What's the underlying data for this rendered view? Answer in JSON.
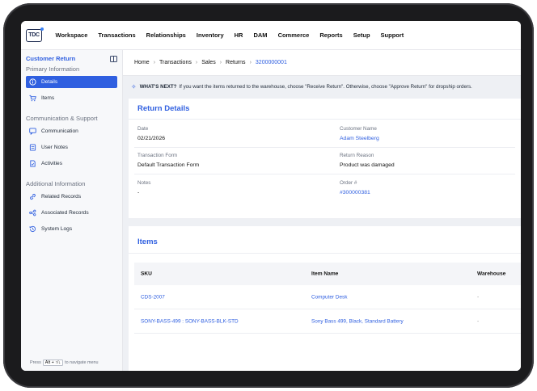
{
  "logo": {
    "text": "TDC"
  },
  "nav": [
    "Workspace",
    "Transactions",
    "Relationships",
    "Inventory",
    "HR",
    "DAM",
    "Commerce",
    "Reports",
    "Setup",
    "Support"
  ],
  "sidebar": {
    "title": "Customer Return",
    "sections": [
      {
        "label": "Primary Information",
        "items": [
          {
            "label": "Details",
            "icon": "info-icon",
            "active": true
          },
          {
            "label": "Items",
            "icon": "cart-icon",
            "active": false
          }
        ]
      },
      {
        "label": "Communication & Support",
        "items": [
          {
            "label": "Communication",
            "icon": "chat-icon",
            "active": false
          },
          {
            "label": "User Notes",
            "icon": "note-icon",
            "active": false
          },
          {
            "label": "Activities",
            "icon": "activity-icon",
            "active": false
          }
        ]
      },
      {
        "label": "Additional Information",
        "items": [
          {
            "label": "Related Records",
            "icon": "link-icon",
            "active": false
          },
          {
            "label": "Associated Records",
            "icon": "associate-icon",
            "active": false
          },
          {
            "label": "System Logs",
            "icon": "history-icon",
            "active": false
          }
        ]
      }
    ],
    "footer": {
      "prefix": "Press",
      "keys": "Alt + ↑/↓",
      "suffix": "to navigate menu"
    }
  },
  "breadcrumb": [
    "Home",
    "Transactions",
    "Sales",
    "Returns",
    "3200000001"
  ],
  "hint": {
    "title": "WHAT'S NEXT?",
    "text": "If you want the items returned to the warehouse, choose \"Receive Return\". Otherwise, choose \"Approve Return\" for dropship orders."
  },
  "details": {
    "title": "Return Details",
    "fields": {
      "date": {
        "label": "Date",
        "value": "02/21/2026"
      },
      "customer": {
        "label": "Customer Name",
        "value": "Adam Steelberg"
      },
      "form": {
        "label": "Transaction Form",
        "value": "Default Transaction Form"
      },
      "reason": {
        "label": "Return Reason",
        "value": "Product was damaged"
      },
      "notes": {
        "label": "Notes",
        "value": "-"
      },
      "order": {
        "label": "Order #",
        "value": "#300000381"
      }
    }
  },
  "items": {
    "title": "Items",
    "columns": [
      "SKU",
      "Item Name",
      "Warehouse"
    ],
    "rows": [
      {
        "sku": "CDS-2007",
        "name": "Computer Desk",
        "warehouse": "-"
      },
      {
        "sku": "SONY-BASS-499 : SONY-BASS-BLK-STD",
        "name": "Sony Bass 499, Black, Standard Battery",
        "warehouse": "-"
      }
    ]
  },
  "colors": {
    "accent": "#2f5fe0",
    "frame": "#1b1b1d"
  }
}
